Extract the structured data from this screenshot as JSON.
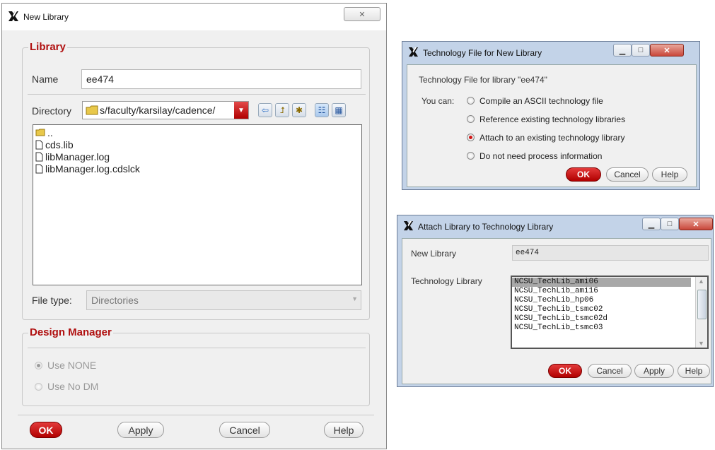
{
  "new_library": {
    "title": "New Library",
    "close_symbol": "✕",
    "library_group": "Library",
    "name_label": "Name",
    "name_value": "ee474",
    "directory_label": "Directory",
    "directory_value": "s/faculty/karsilay/cadence/",
    "files": [
      {
        "name": "..",
        "icon": "folder-icon"
      },
      {
        "name": "cds.lib",
        "icon": "file-icon"
      },
      {
        "name": "libManager.log",
        "icon": "file-icon"
      },
      {
        "name": "libManager.log.cdslck",
        "icon": "file-icon"
      }
    ],
    "file_type_label": "File type:",
    "file_type_value": "Directories",
    "design_manager_group": "Design Manager",
    "dm_options": [
      "Use NONE",
      "Use No DM"
    ],
    "buttons": {
      "ok": "OK",
      "apply": "Apply",
      "cancel": "Cancel",
      "help": "Help"
    }
  },
  "tech_file": {
    "title": "Technology File for New Library",
    "header": "Technology File for library \"ee474\"",
    "you_can_label": "You can:",
    "options": [
      "Compile an ASCII technology file",
      "Reference existing technology libraries",
      "Attach to an existing technology library",
      "Do not need process information"
    ],
    "selected_index": 2,
    "buttons": {
      "ok": "OK",
      "cancel": "Cancel",
      "help": "Help"
    }
  },
  "attach": {
    "title": "Attach Library to Technology Library",
    "new_library_label": "New Library",
    "new_library_value": "ee474",
    "tech_library_label": "Technology Library",
    "tech_libraries": [
      "NCSU_TechLib_ami06",
      "NCSU_TechLib_ami16",
      "NCSU_TechLib_hp06",
      "NCSU_TechLib_tsmc02",
      "NCSU_TechLib_tsmc02d",
      "NCSU_TechLib_tsmc03"
    ],
    "selected_index": 0,
    "buttons": {
      "ok": "OK",
      "cancel": "Cancel",
      "apply": "Apply",
      "help": "Help"
    }
  },
  "colors": {
    "accent_red": "#b01010",
    "ok_red": "#c00000"
  }
}
